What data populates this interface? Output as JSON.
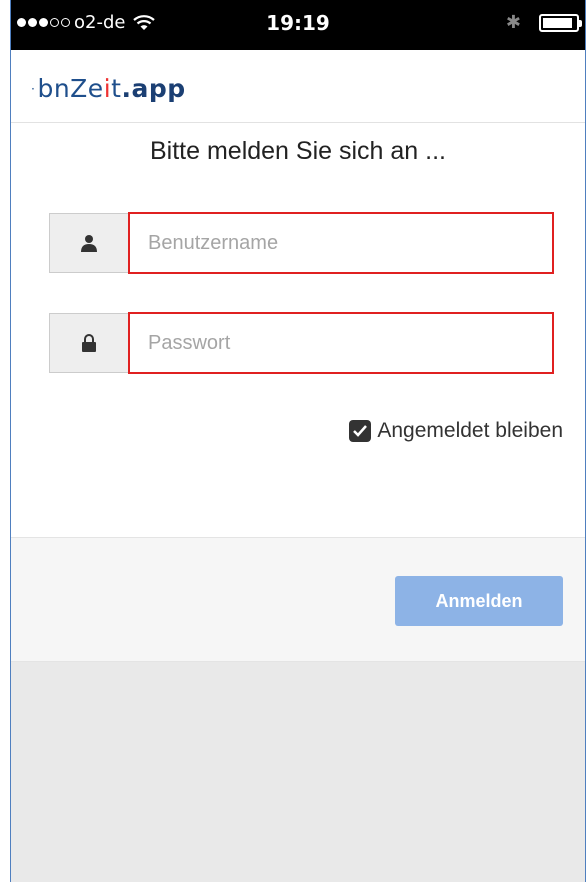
{
  "statusbar": {
    "carrier": "o2-de",
    "time": "19:19",
    "signal_bars_full": 3,
    "signal_bars_total": 5,
    "battery_level": 0.9
  },
  "header": {
    "logo_prefix": "bnZe",
    "logo_t": "t",
    "logo_suffix": ".app"
  },
  "form": {
    "title": "Bitte melden Sie sich an ...",
    "username": {
      "value": "",
      "placeholder": "Benutzername",
      "icon": "user-icon"
    },
    "password": {
      "value": "",
      "placeholder": "Passwort",
      "icon": "lock-icon"
    },
    "remember_label": "Angemeldet bleiben",
    "remember_checked": true
  },
  "footer": {
    "login_label": "Anmelden"
  },
  "colors": {
    "accent": "#8db3e6",
    "error_border": "#e02020",
    "logo": "#1f4f8c"
  }
}
